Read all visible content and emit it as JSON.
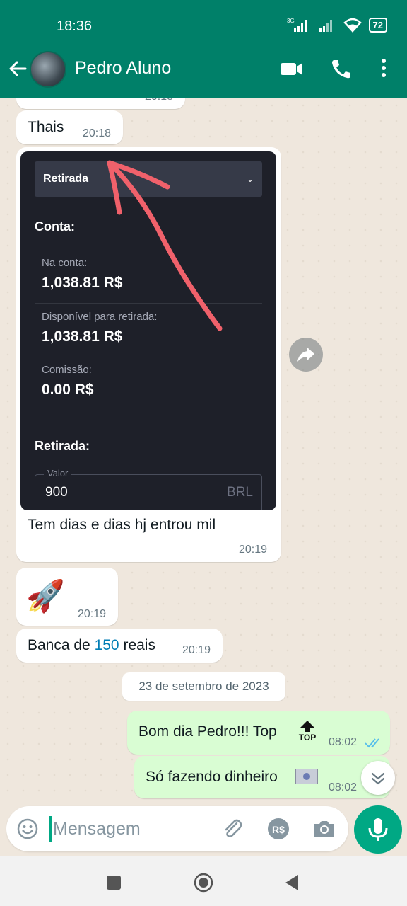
{
  "status": {
    "time": "18:36",
    "network_labels": [
      "3G"
    ],
    "battery": "72"
  },
  "header": {
    "contact_name": "Pedro Aluno"
  },
  "chat": {
    "partial_time": "20:18",
    "msg_thais": {
      "text": "Thais",
      "time": "20:18"
    },
    "screenshot": {
      "select_label": "Retirada",
      "section_account": "Conta:",
      "rows": [
        {
          "label": "Na conta:",
          "value": "1,038.81 R$"
        },
        {
          "label": "Disponível para retirada:",
          "value": "1,038.81 R$"
        },
        {
          "label": "Comissão:",
          "value": "0.00 R$"
        }
      ],
      "section_withdraw": "Retirada:",
      "field_legend": "Valor",
      "field_value": "900",
      "field_unit": "BRL"
    },
    "msg_caption": {
      "text": "Tem dias e dias hj entrou mil",
      "time": "20:19"
    },
    "msg_rocket": {
      "emoji": "🚀",
      "time": "20:19"
    },
    "msg_banca": {
      "prefix": "Banca de ",
      "number": "150",
      "suffix": " reais",
      "time": "20:19"
    },
    "date_separator": "23 de setembro de 2023",
    "msg_out1": {
      "text": "Bom dia Pedro!!! Top",
      "sticker": "TOP",
      "time": "08:02"
    },
    "msg_out2": {
      "text": "Só fazendo dinheiro",
      "time": "08:02"
    }
  },
  "input": {
    "placeholder": "Mensagem"
  },
  "colors": {
    "header": "#008069",
    "accent": "#00a884",
    "outgoing": "#d9fdd3",
    "link": "#027eb5",
    "annotation": "#f0616b"
  },
  "icons": [
    "back-arrow-icon",
    "video-call-icon",
    "phone-icon",
    "more-vertical-icon",
    "forward-icon",
    "chevron-double-down-icon",
    "emoji-icon",
    "attach-icon",
    "payment-icon",
    "camera-icon",
    "mic-icon",
    "recents-icon",
    "home-icon",
    "back-icon"
  ]
}
